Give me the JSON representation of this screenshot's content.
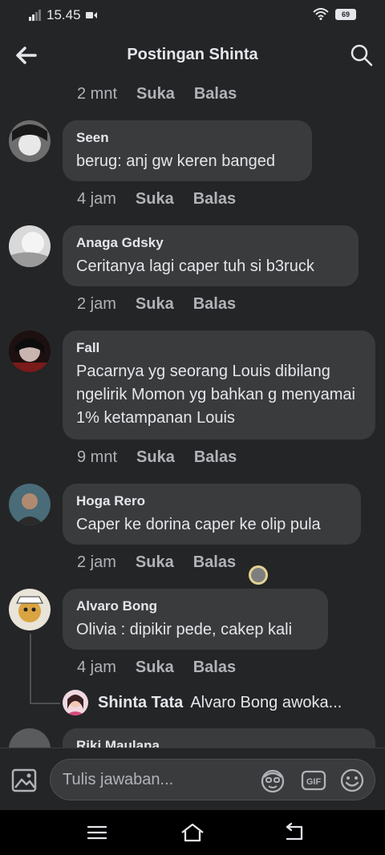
{
  "status_bar": {
    "time": "15.45",
    "battery": "69"
  },
  "header": {
    "title": "Postingan Shinta"
  },
  "labels": {
    "like": "Suka",
    "reply": "Balas"
  },
  "comments": [
    {
      "name": "Seen",
      "text": "berug: anj gw keren banged",
      "time": "4 jam"
    },
    {
      "name": "Anaga Gdsky",
      "text": "Ceritanya lagi caper tuh si b3ruck",
      "time": "2 jam"
    },
    {
      "name": "Fall",
      "text": "Pacarnya yg seorang Louis dibilang ngelirik Momon yg bahkan g menyamai 1% ketampanan Louis",
      "time": "9 mnt"
    },
    {
      "name": "Hoga Rero",
      "text": "Caper ke dorina caper ke olip pula",
      "time": "2 jam"
    },
    {
      "name": "Alvaro Bong",
      "text": "Olivia : dipikir pede, cakep kali",
      "time": "4 jam"
    }
  ],
  "top_meta": {
    "time": "2 mnt"
  },
  "reply": {
    "name": "Shinta Tata",
    "text": "Alvaro Bong awoka..."
  },
  "partial_comment": {
    "name": "Riki Maulana"
  },
  "composer": {
    "placeholder": "Tulis jawaban..."
  },
  "colors": {
    "background": "#242526",
    "bubble": "#3a3b3c",
    "text": "#e4e6eb",
    "muted": "#b0b3b8"
  }
}
